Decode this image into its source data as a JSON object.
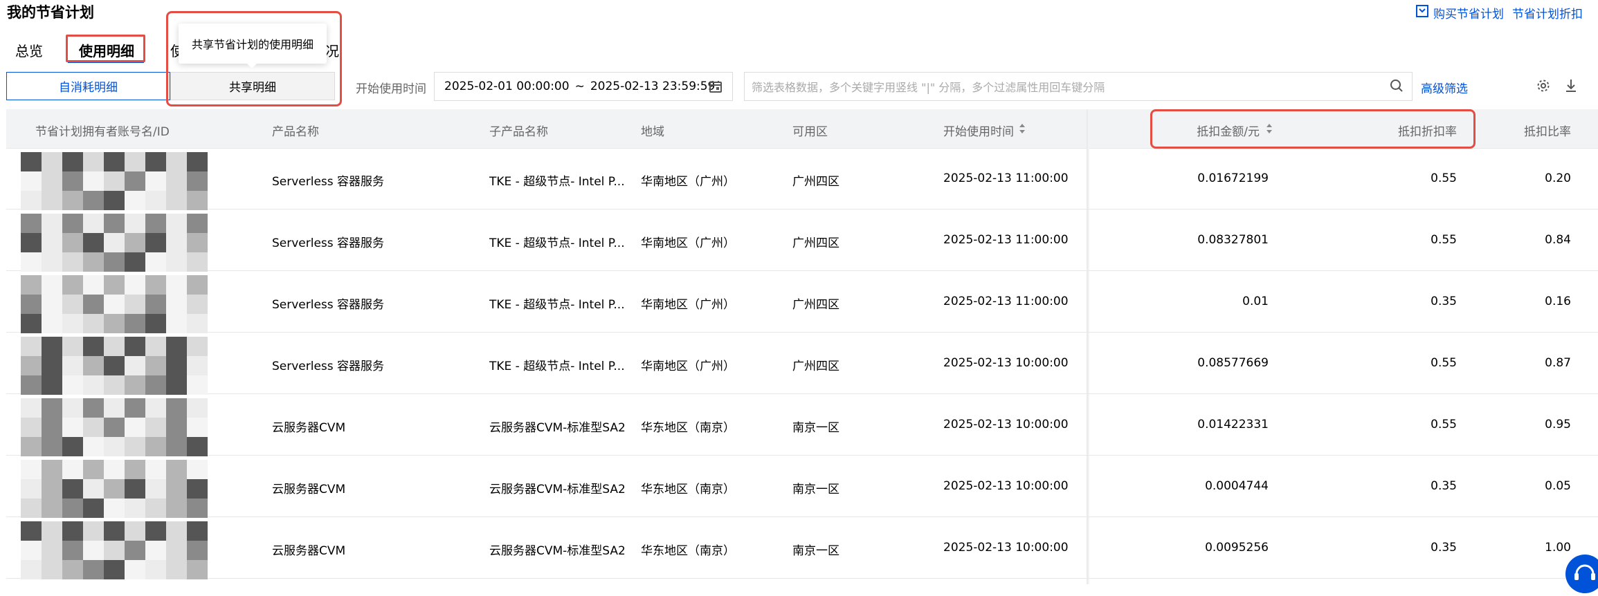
{
  "page_title": "我的节省计划",
  "tabs": [
    {
      "label": "总览"
    },
    {
      "label": "使用明细"
    },
    {
      "label": "使"
    },
    {
      "label": "况"
    }
  ],
  "top_links": {
    "buy": "购买节省计划",
    "discount": "节省计划折扣"
  },
  "segmented": {
    "self": "自消耗明细",
    "shared": "共享明细"
  },
  "tooltip": "共享节省计划的使用明细",
  "filter": {
    "date_label": "开始使用时间",
    "date_start": "2025-02-01 00:00:00",
    "date_sep": "~",
    "date_end": "2025-02-13 23:59:59",
    "search_placeholder": "筛选表格数据，多个关键字用竖线 \"|\" 分隔，多个过滤属性用回车键分隔",
    "advanced": "高级筛选"
  },
  "columns": [
    "节省计划拥有者账号名/ID",
    "产品名称",
    "子产品名称",
    "地域",
    "可用区",
    "开始使用时间",
    "抵扣金额/元",
    "抵扣折扣率",
    "抵扣比率"
  ],
  "rows": [
    {
      "product": "Serverless 容器服务",
      "sub": "TKE - 超级节点- Intel P...",
      "region": "华南地区（广州）",
      "zone": "广州四区",
      "start": "2025-02-13 11:00:00",
      "amount": "0.01672199",
      "rate": "0.55",
      "ratio": "0.20"
    },
    {
      "product": "Serverless 容器服务",
      "sub": "TKE - 超级节点- Intel P...",
      "region": "华南地区（广州）",
      "zone": "广州四区",
      "start": "2025-02-13 11:00:00",
      "amount": "0.08327801",
      "rate": "0.55",
      "ratio": "0.84"
    },
    {
      "product": "Serverless 容器服务",
      "sub": "TKE - 超级节点- Intel P...",
      "region": "华南地区（广州）",
      "zone": "广州四区",
      "start": "2025-02-13 11:00:00",
      "amount": "0.01",
      "rate": "0.35",
      "ratio": "0.16"
    },
    {
      "product": "Serverless 容器服务",
      "sub": "TKE - 超级节点- Intel P...",
      "region": "华南地区（广州）",
      "zone": "广州四区",
      "start": "2025-02-13 10:00:00",
      "amount": "0.08577669",
      "rate": "0.55",
      "ratio": "0.87"
    },
    {
      "product": "云服务器CVM",
      "sub": "云服务器CVM-标准型SA2",
      "region": "华东地区（南京）",
      "zone": "南京一区",
      "start": "2025-02-13 10:00:00",
      "amount": "0.01422331",
      "rate": "0.55",
      "ratio": "0.95"
    },
    {
      "product": "云服务器CVM",
      "sub": "云服务器CVM-标准型SA2",
      "region": "华东地区（南京）",
      "zone": "南京一区",
      "start": "2025-02-13 10:00:00",
      "amount": "0.0004744",
      "rate": "0.35",
      "ratio": "0.05"
    },
    {
      "product": "云服务器CVM",
      "sub": "云服务器CVM-标准型SA2",
      "region": "华东地区（南京）",
      "zone": "南京一区",
      "start": "2025-02-13 10:00:00",
      "amount": "0.0095256",
      "rate": "0.35",
      "ratio": "1.00"
    }
  ],
  "colors": {
    "accent": "#0052d9",
    "highlight": "#e34d43"
  }
}
